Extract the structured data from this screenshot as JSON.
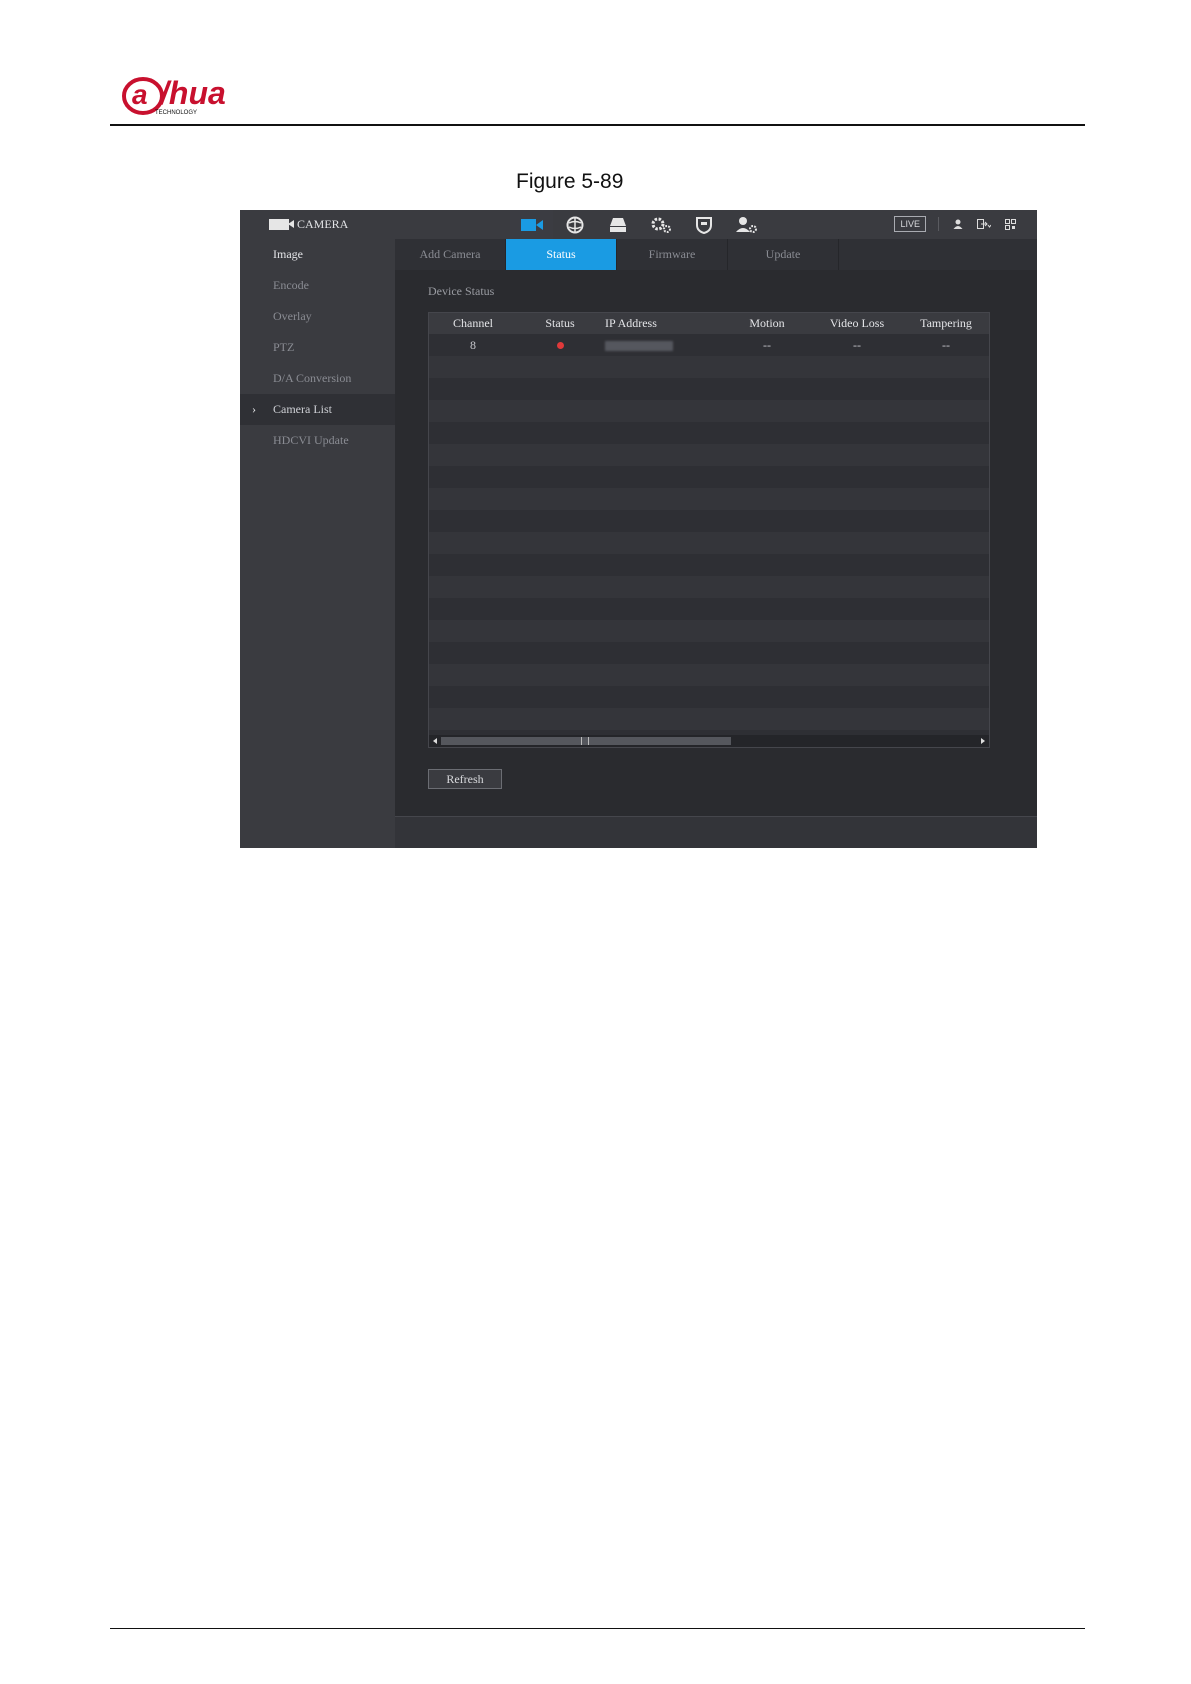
{
  "logo": {
    "text": "alhua",
    "subtext": "TECHNOLOGY",
    "color": "#c8102e"
  },
  "caption": "Figure 5-89",
  "topbar": {
    "app_title": "CAMERA",
    "live_label": "LIVE",
    "modules": [
      "camera-icon",
      "network-icon",
      "storage-icon",
      "system-icon",
      "security-icon",
      "account-icon"
    ]
  },
  "sidebar": {
    "items": [
      {
        "label": "Image"
      },
      {
        "label": "Encode"
      },
      {
        "label": "Overlay"
      },
      {
        "label": "PTZ"
      },
      {
        "label": "D/A Conversion"
      },
      {
        "label": "Camera List"
      },
      {
        "label": "HDCVI Update"
      }
    ]
  },
  "tabs": [
    {
      "label": "Add Camera"
    },
    {
      "label": "Status"
    },
    {
      "label": "Firmware"
    },
    {
      "label": "Update"
    }
  ],
  "section_title": "Device Status",
  "table": {
    "columns": [
      "Channel",
      "Status",
      "IP Address",
      "Motion",
      "Video Loss",
      "Tampering"
    ],
    "rows": [
      {
        "channel": "8",
        "status": "offline-dot",
        "ip": "",
        "motion": "--",
        "video_loss": "--",
        "tampering": "--"
      }
    ]
  },
  "buttons": {
    "refresh": "Refresh"
  },
  "colors": {
    "accent": "#1a9be3",
    "status_red": "#e0393a"
  }
}
